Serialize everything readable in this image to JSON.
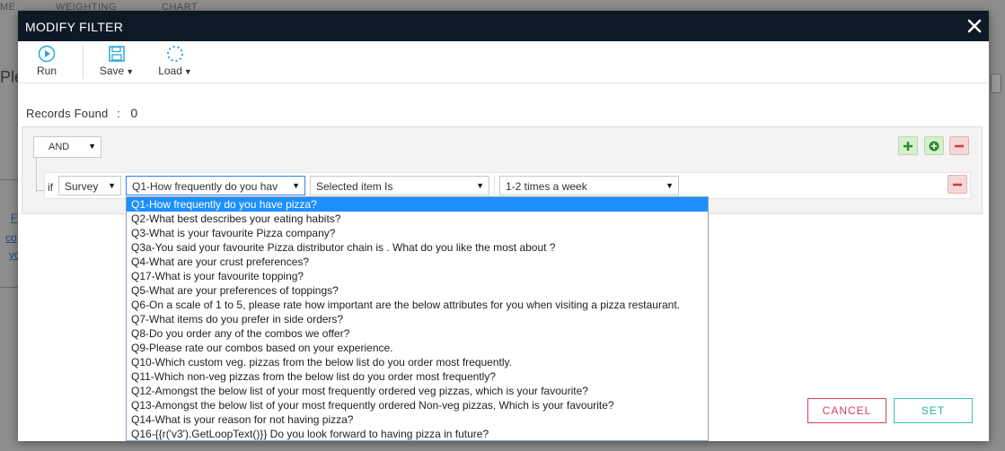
{
  "background": {
    "tabs": [
      "ME",
      "WEIGHTING",
      "CHART"
    ],
    "partial_heading": "Ple",
    "partial_links": [
      "F",
      "co",
      "yo"
    ]
  },
  "modal": {
    "title": "MODIFY FILTER",
    "close_icon": "close-icon"
  },
  "toolbar": {
    "run_label": "Run",
    "save_label": "Save",
    "load_label": "Load",
    "run_icon": "play-circle-icon",
    "save_icon": "floppy-disk-icon",
    "load_icon": "spinner-icon"
  },
  "records": {
    "label": "Records Found",
    "separator": ":",
    "value": "0"
  },
  "filter": {
    "logic": "AND",
    "if_label": "if",
    "survey": "Survey",
    "question": "Q1-How frequently do you hav",
    "operator": "Selected item Is",
    "value": "1-2 times a week"
  },
  "dropdown": {
    "items": [
      "Q1-How frequently do you have pizza?",
      "Q2-What best describes your eating habits?",
      "Q3-What is your favourite Pizza company?",
      "Q3a-You said your favourite Pizza distributor chain is . What do you like the most about ?",
      "Q4-What are your crust preferences?",
      "Q17-What is your favourite topping?",
      "Q5-What are your preferences of toppings?",
      "Q6-On a scale of 1 to 5, please rate how important are the below attributes for you when visiting a pizza restaurant.",
      "Q7-What items do you prefer in side orders?",
      "Q8-Do you order any of the combos we offer?",
      "Q9-Please rate our combos based on your experience.",
      "Q10-Which custom veg. pizzas from the below list do you order most frequently.",
      "Q11-Which non-veg pizzas from the below list do you order most frequently?",
      "Q12-Amongst the below list of your most frequently ordered veg pizzas, which is your favourite?",
      "Q13-Amongst the below list of your most frequently ordered Non-veg pizzas, Which is your favourite?",
      "Q14-What is your reason for not having pizza?",
      "Q16-{{r('v3').GetLoopText()}} Do you look forward to having pizza in future?"
    ],
    "selected_index": 0
  },
  "buttons": {
    "cancel": "CANCEL",
    "set": "SET"
  },
  "colors": {
    "header_bg": "#0d1a26",
    "selected_bg": "#1e8fff",
    "cancel": "#d9415a",
    "set": "#3ebfb4",
    "add_green": "#2e8b2e",
    "remove_red": "#d23c3c"
  }
}
